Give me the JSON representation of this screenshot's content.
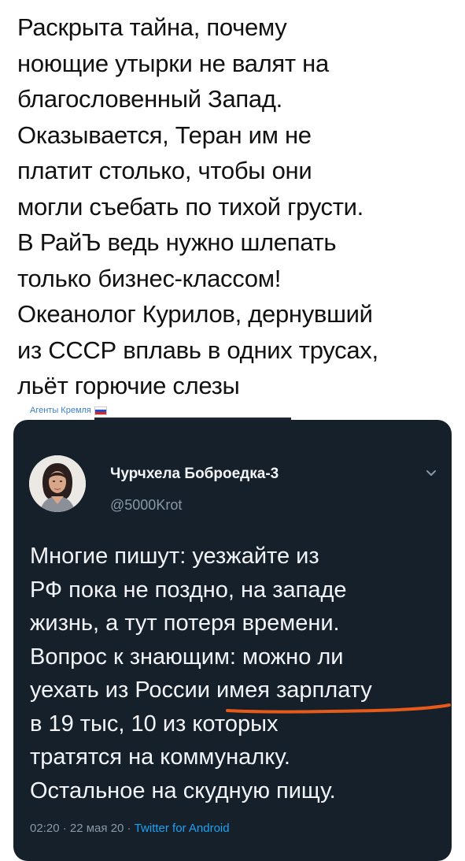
{
  "post": {
    "lines": [
      "Раскрыта тайна, почему",
      "ноющие утырки не валят на",
      "благословенный Запад.",
      "Оказывается, Теран им не",
      "платит столько, чтобы они",
      "могли съебать по тихой грусти.",
      "В РайЪ ведь нужно шлепать",
      "только бизнес-классом!",
      "Океанолог Курилов, дернувший",
      "из СССР вплавь в одних трусах,",
      "льёт горючие слезы"
    ]
  },
  "watermark": {
    "label": "Агенты Кремля"
  },
  "quoted_tweet": {
    "display_name": "Чурчхела Боброедка-3",
    "handle": "@5000Krot",
    "lines": [
      "Многие пишут: уезжайте из",
      "РФ пока не поздно, на западе",
      "жизнь, а тут потеря времени.",
      "Вопрос к знающим: можно ли",
      "уехать из России имея зарплату",
      "в 19 тыс, 10 из которых",
      "тратятся на коммуналку.",
      "Остальное на скудную пищу."
    ],
    "time": "02:20",
    "separator": "·",
    "date": "22 мая 20",
    "source": "Twitter for Android"
  },
  "colors": {
    "card_bg": "#16202b",
    "accent_link": "#1da1f2",
    "underline_mark": "#e85a1a",
    "muted_text": "#8899a6"
  }
}
